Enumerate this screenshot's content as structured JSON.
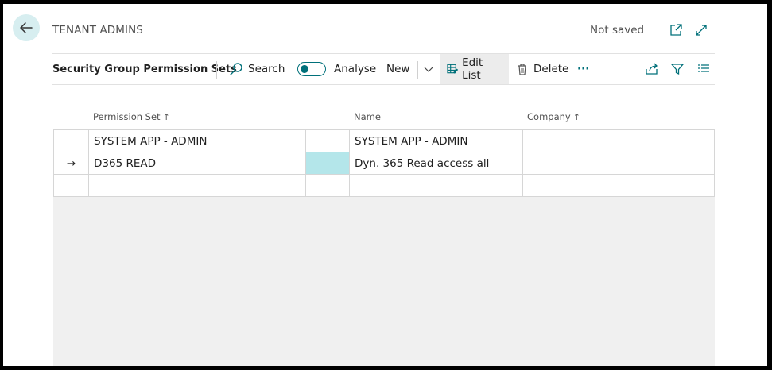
{
  "header": {
    "caption": "TENANT ADMINS",
    "status": "Not saved"
  },
  "actionbar": {
    "title": "Security Group Permission Sets",
    "search": "Search",
    "analyse": "Analyse",
    "new": "New",
    "edit_list": "Edit List",
    "delete": "Delete",
    "more": "···"
  },
  "grid": {
    "columns": {
      "permission_set": "Permission Set",
      "name": "Name",
      "company": "Company",
      "sort_arrow": "↑"
    },
    "rows": [
      {
        "marker": "",
        "permission_set": "SYSTEM APP - ADMIN",
        "name": "SYSTEM APP - ADMIN",
        "company": ""
      },
      {
        "marker": "→",
        "permission_set": "D365 READ",
        "name": "Dyn. 365 Read access all",
        "company": ""
      },
      {
        "marker": "",
        "permission_set": "",
        "name": "",
        "company": ""
      }
    ]
  },
  "colors": {
    "accent": "#00707a",
    "selected_cell": "#b4e6ea",
    "back_button_bg": "#d7eef0"
  }
}
